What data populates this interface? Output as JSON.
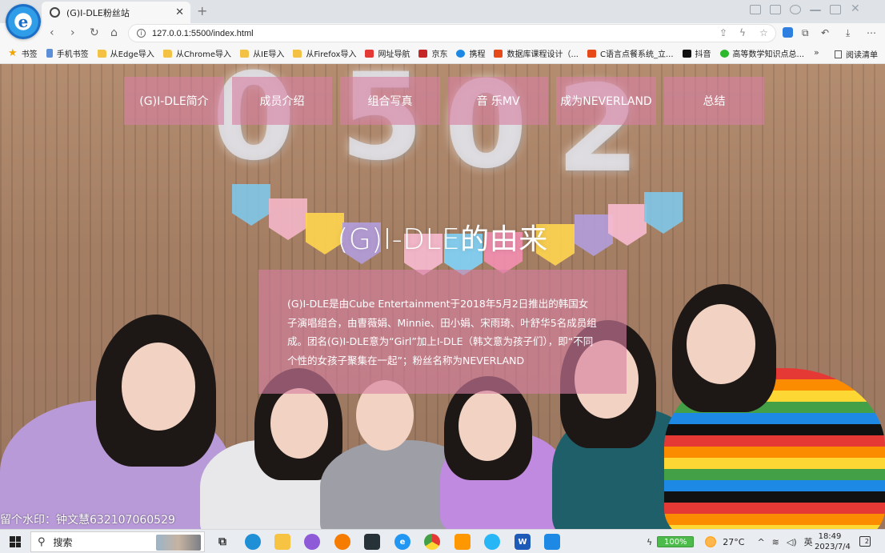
{
  "browser": {
    "logo_glyph": "e",
    "tab": {
      "title": "(G)I-DLE粉丝站",
      "close": "✕"
    },
    "new_tab": "+",
    "address": {
      "url": "127.0.0.1:5500/index.html",
      "info": "i"
    },
    "nav": {
      "back": "‹",
      "forward": "›",
      "reload": "↻",
      "home": "⌂"
    },
    "bookmarks": [
      {
        "label": "书签",
        "icon": "star-icon"
      },
      {
        "label": "手机书签",
        "icon": "phone-icon"
      },
      {
        "label": "从Edge导入",
        "icon": "folder-icon"
      },
      {
        "label": "从Chrome导入",
        "icon": "folder-icon"
      },
      {
        "label": "从IE导入",
        "icon": "folder-icon"
      },
      {
        "label": "从Firefox导入",
        "icon": "folder-icon"
      },
      {
        "label": "网址导航",
        "icon": "nav-site-icon"
      },
      {
        "label": "京东",
        "icon": "jd-icon"
      },
      {
        "label": "携程",
        "icon": "ctrip-icon"
      },
      {
        "label": "数据库课程设计（...",
        "icon": "c-icon"
      },
      {
        "label": "C语言点餐系统_立...",
        "icon": "c-icon"
      },
      {
        "label": "抖音",
        "icon": "douyin-icon"
      },
      {
        "label": "高等数学知识点总...",
        "icon": "wechat-icon"
      }
    ],
    "bookmarks_more": "»",
    "reading_list": "阅读清单"
  },
  "page": {
    "menu": [
      "(G)I-DLE简介",
      "成员介绍",
      "组合写真",
      "音 乐MV",
      "成为NEVERLAND",
      "总结"
    ],
    "title": "(G)I-DLE的由来",
    "intro": "(G)I-DLE是由Cube Entertainment于2018年5月2日推出的韩国女子演唱组合，由曺薇娟、Minnie、田小娟、宋雨琦、叶舒华5名成员组成。团名(G)I-DLE意为“Girl”加上I-DLE（韩文意为孩子们），即“不同个性的女孩子聚集在一起”；粉丝名称为NEVERLAND",
    "watermark": "留个水印：钟文慧632107060529",
    "balloons": [
      "0",
      "5",
      "0",
      "2"
    ]
  },
  "taskbar": {
    "search_placeholder": "搜索",
    "apps": [
      "task-view",
      "edge",
      "file-explorer",
      "app-purple",
      "firefox",
      "terminal",
      "browser-e",
      "chrome",
      "app-orange",
      "app-circle",
      "word",
      "vscode"
    ],
    "battery": "100%",
    "weather": "27°C",
    "ime": "英",
    "time": "18:49",
    "date": "2023/7/4",
    "notification_count": "2"
  },
  "colors": {
    "menu_bg": "#d680a2",
    "accent_blue": "#1c6fc4"
  }
}
